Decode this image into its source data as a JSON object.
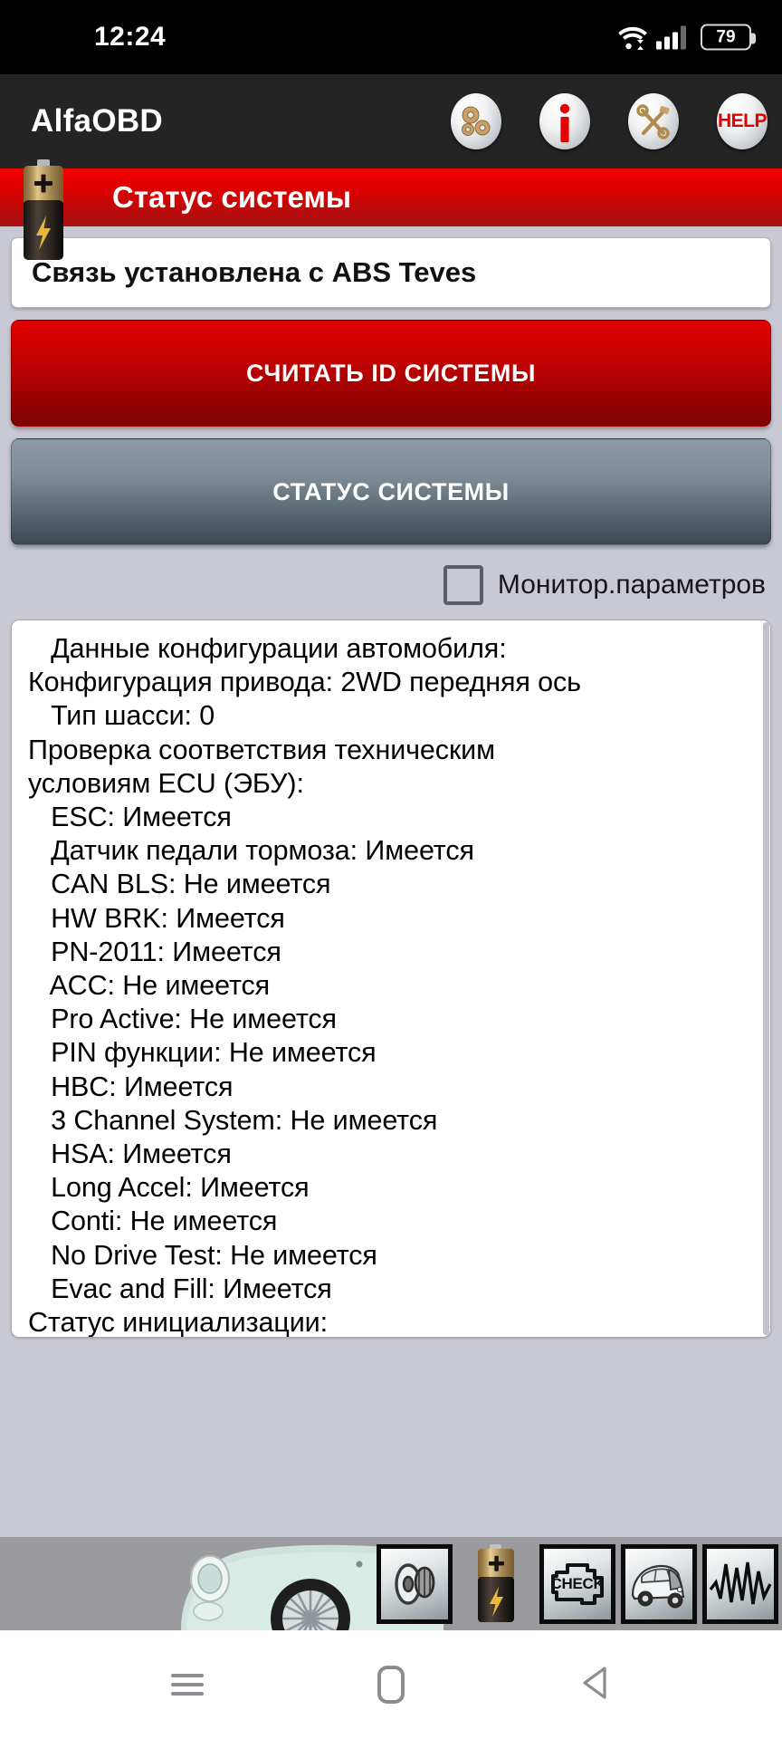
{
  "status_bar": {
    "clock": "12:24",
    "wifi_icon": "wifi-icon",
    "signal_icon": "cellular-signal-icon",
    "battery_level": "79"
  },
  "app_bar": {
    "title": "AlfaOBD",
    "buttons": [
      {
        "name": "settings-gears-icon",
        "label": ""
      },
      {
        "name": "info-icon",
        "label": ""
      },
      {
        "name": "tools-icon",
        "label": ""
      },
      {
        "name": "help-icon",
        "label": "HELP"
      }
    ]
  },
  "title_bar": {
    "title": "Статус системы",
    "icon": "battery-icon",
    "color": "#e00000"
  },
  "status_field": {
    "value": "Связь установлена с ABS Teves"
  },
  "buttons": {
    "read_id": "СЧИТАТЬ ID СИСТЕМЫ",
    "system_status": "СТАТУС СИСТЕМЫ"
  },
  "checkbox": {
    "label": "Монитор.параметров",
    "checked": false
  },
  "log": {
    "lines": [
      "   Данные конфигурации автомобиля:",
      "Конфигурация привода: 2WD передняя ось",
      "   Тип шасси: 0",
      "Проверка соответствия техническим",
      "условиям ECU (ЭБУ):",
      "   ESC: Имеется",
      "   Датчик педали тормоза: Имеется",
      "   CAN BLS: Не имеется",
      "   HW BRK: Имеется",
      "   PN-2011: Имеется",
      "   ACC: Не имеется",
      "   Pro Active: Не имеется",
      "   PIN функции: Не имеется",
      "   HBC: Имеется",
      "   3 Channel System: Не имеется",
      "   HSA: Имеется",
      "   Long Accel: Имеется",
      "   Conti: Не имеется",
      "   No Drive Test: Не имеется",
      "   Evac and Fill: Имеется",
      "Статус инициализации:"
    ]
  },
  "bottom_toolbar": {
    "car_image": "fiat-500-photo",
    "items": [
      {
        "name": "brake-disc-icon",
        "label": "",
        "active": false
      },
      {
        "name": "battery-icon",
        "label": "",
        "active": true
      },
      {
        "name": "check-engine-icon",
        "label": "CHECK",
        "active": false
      },
      {
        "name": "classic-car-icon",
        "label": "",
        "active": false
      },
      {
        "name": "waveform-icon",
        "label": "",
        "active": false
      }
    ]
  },
  "nav_bar": {
    "menu": "menu-icon",
    "home": "home-icon",
    "back": "back-icon"
  }
}
